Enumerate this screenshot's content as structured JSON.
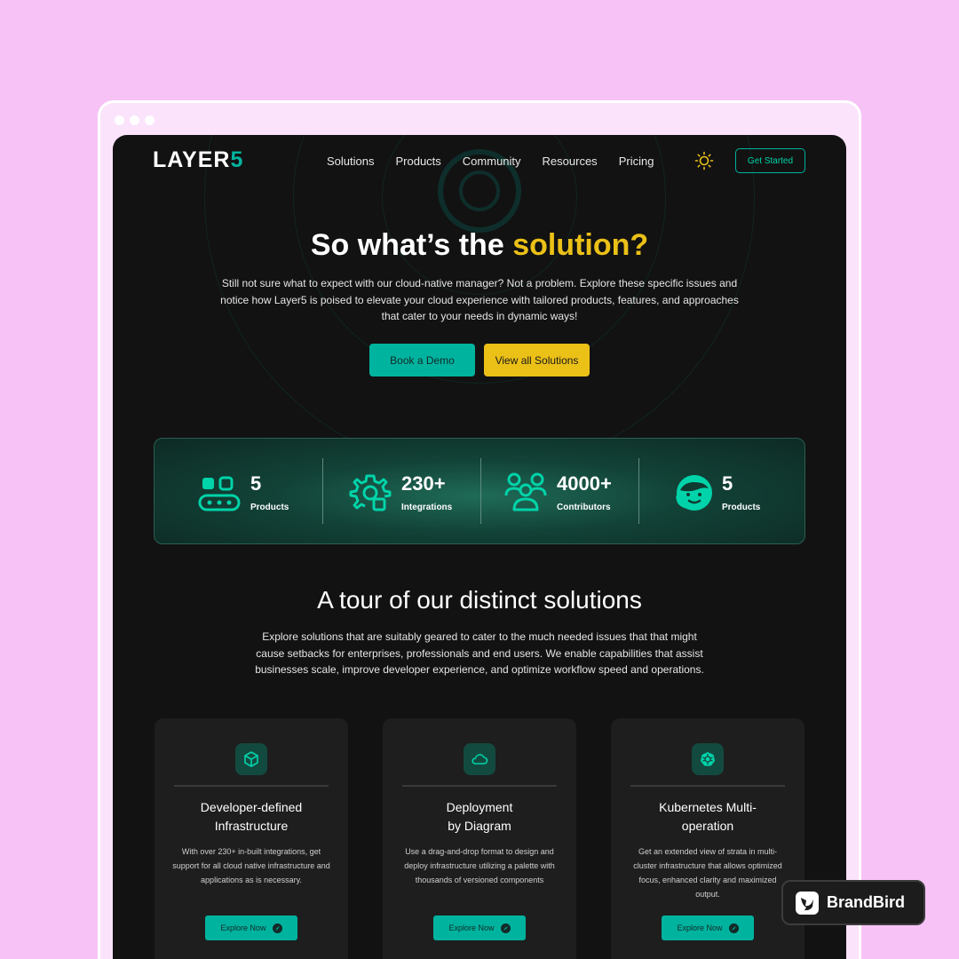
{
  "nav": {
    "logo_main": "LAYER",
    "logo_accent": "5",
    "links": [
      "Solutions",
      "Products",
      "Community",
      "Resources",
      "Pricing"
    ],
    "cta": "Get Started"
  },
  "hero": {
    "title_main": "So what’s the",
    "title_accent": "solution?",
    "description": "Still not sure what to expect with our cloud-native manager? Not a problem. Explore these specific issues and notice how Layer5 is poised to elevate your cloud experience with tailored products, features, and approaches that cater to your needs in dynamic ways!",
    "btn_demo": "Book a Demo",
    "btn_solutions": "View all Solutions"
  },
  "stats": [
    {
      "value": "5",
      "label": "Products",
      "icon": "conveyor-icon"
    },
    {
      "value": "230+",
      "label": "Integrations",
      "icon": "gear-integrations-icon"
    },
    {
      "value": "4000+",
      "label": "Contributors",
      "icon": "people-group-icon"
    },
    {
      "value": "5",
      "label": "Products",
      "icon": "support-agent-icon"
    }
  ],
  "section": {
    "title": "A tour of our distinct solutions",
    "description": "Explore solutions that are suitably geared to cater to the much needed issues that that might cause setbacks for enterprises, professionals and end users. We enable capabilities that assist businesses scale, improve developer experience, and optimize workflow speed and operations."
  },
  "cards": [
    {
      "title_l1": "Developer-defined",
      "title_l2": "Infrastructure",
      "text": "With over 230+ in-built integrations, get support for all cloud native infrastructure and applications as is necessary.",
      "button": "Explore Now",
      "icon": "cube-icon"
    },
    {
      "title_l1": "Deployment",
      "title_l2": "by Diagram",
      "text": "Use a drag-and-drop format to design and deploy infrastructure utilizing a palette with thousands of versioned components",
      "button": "Explore Now",
      "icon": "cloud-icon"
    },
    {
      "title_l1": "Kubernetes Multi-",
      "title_l2": "operation",
      "text": "Get an extended view of strata in multi-cluster infrastructure that allows optimized focus, enhanced clarity and maximized output.",
      "button": "Explore Now",
      "icon": "kubernetes-icon"
    }
  ],
  "badge": {
    "text": "BrandBird"
  },
  "colors": {
    "accent": "#00b39f",
    "yellow": "#ebc017",
    "background": "#121212",
    "page": "#f7c3f7"
  }
}
